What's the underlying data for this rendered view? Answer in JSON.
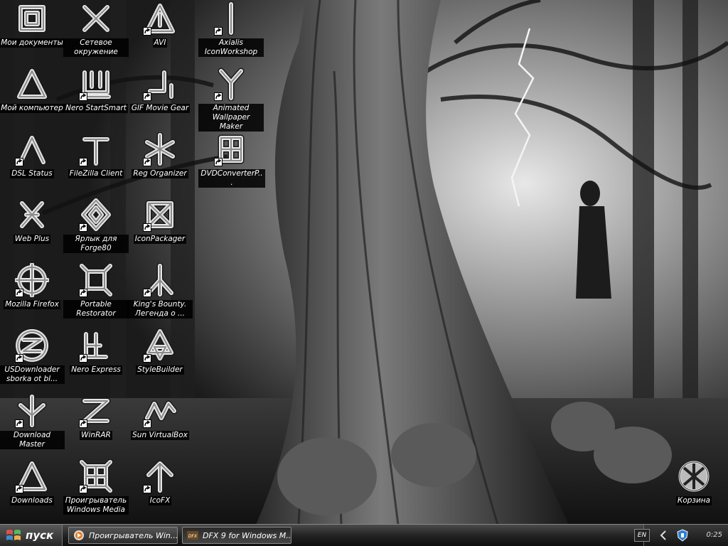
{
  "desktop": {
    "icons": [
      {
        "id": "my-documents",
        "label": "Мои документы",
        "icon": "square-rune-icon",
        "shortcut": false
      },
      {
        "id": "network",
        "label": "Сетевое окружение",
        "icon": "x-rune-icon",
        "shortcut": false
      },
      {
        "id": "avi",
        "label": "AVI",
        "icon": "triangle-rune-icon",
        "shortcut": true
      },
      {
        "id": "axialis",
        "label": "Axialis IconWorkshop",
        "icon": "bar-rune-icon",
        "shortcut": true
      },
      {
        "id": "my-computer",
        "label": "Мой компьютер",
        "icon": "delta-rune-icon",
        "shortcut": false
      },
      {
        "id": "nero-startsmart",
        "label": "Nero StartSmart",
        "icon": "shcha-rune-icon",
        "shortcut": true
      },
      {
        "id": "gif-movie-gear",
        "label": "GIF Movie Gear",
        "icon": "hook-rune-icon",
        "shortcut": true
      },
      {
        "id": "animated-wallpaper",
        "label": "Animated Wallpaper Maker",
        "icon": "fork-rune-icon",
        "shortcut": true
      },
      {
        "id": "dsl-status",
        "label": "DSL Status",
        "icon": "caret-rune-icon",
        "shortcut": true
      },
      {
        "id": "filezilla",
        "label": "FileZilla Client",
        "icon": "tee-rune-icon",
        "shortcut": true
      },
      {
        "id": "reg-organizer",
        "label": "Reg Organizer",
        "icon": "star-rune-icon",
        "shortcut": true
      },
      {
        "id": "dvdconverter",
        "label": "DVDConverterP...",
        "icon": "grid-rune-icon",
        "shortcut": true
      },
      {
        "id": "web-plus",
        "label": "Web Plus",
        "icon": "cross-rune-icon",
        "shortcut": false
      },
      {
        "id": "forge80",
        "label": "Ярлык для Forge80",
        "icon": "diamond-rune-icon",
        "shortcut": true
      },
      {
        "id": "iconpackager",
        "label": "IconPackager",
        "icon": "burst-rune-icon",
        "shortcut": true
      },
      {
        "id": "firefox",
        "label": "Mozilla Firefox",
        "icon": "target-rune-icon",
        "shortcut": true
      },
      {
        "id": "portable-restorator",
        "label": "Portable Restorator",
        "icon": "frame-rune-icon",
        "shortcut": true
      },
      {
        "id": "kings-bounty",
        "label": "King's Bounty. Легенда о ...",
        "icon": "y-rune-icon",
        "shortcut": true
      },
      {
        "id": "usdownloader",
        "label": "USDownloader sborka ot bl...",
        "icon": "circle-rune-icon",
        "shortcut": true
      },
      {
        "id": "nero-express",
        "label": "Nero Express",
        "icon": "e-rune-icon",
        "shortcut": true
      },
      {
        "id": "stylebuilder",
        "label": "StyleBuilder",
        "icon": "knot-rune-icon",
        "shortcut": true
      },
      {
        "id": "download-master",
        "label": "Download Master",
        "icon": "arrow-down-rune-icon",
        "shortcut": true
      },
      {
        "id": "winrar",
        "label": "WinRAR",
        "icon": "z-rune-icon",
        "shortcut": true
      },
      {
        "id": "virtualbox",
        "label": "Sun VirtualBox",
        "icon": "wave-rune-icon",
        "shortcut": true
      },
      {
        "id": "downloads",
        "label": "Downloads",
        "icon": "delta-rune-icon",
        "shortcut": true
      },
      {
        "id": "windows-media",
        "label": "Проигрыватель Windows Media",
        "icon": "lattice-rune-icon",
        "shortcut": true
      },
      {
        "id": "icofx",
        "label": "IcoFX",
        "icon": "arrow-up-rune-icon",
        "shortcut": true
      }
    ],
    "recycle_bin": {
      "label": "Корзина",
      "icon": "recycle-bin-icon"
    }
  },
  "taskbar": {
    "start_label": "пуск",
    "tasks": [
      {
        "label": "Проигрыватель Win...",
        "icon": "media-player-icon",
        "active": false
      },
      {
        "label": "DFX 9 for Windows M...",
        "icon": "dfx-icon",
        "active": true
      }
    ],
    "tray": {
      "language": "EN",
      "clock": "0:25"
    }
  },
  "colors": {
    "icon_label_bg": "#000000",
    "label_text": "#ffffff"
  }
}
